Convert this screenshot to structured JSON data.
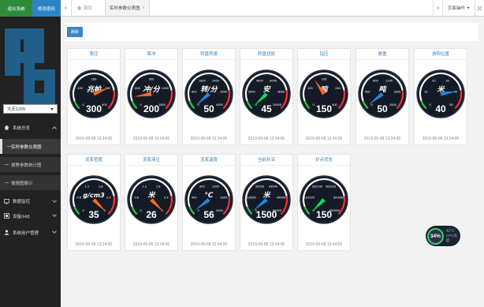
{
  "sidebar": {
    "exit_label": "退出系统",
    "password_label": "修改密码",
    "station": "大庆1205",
    "menu": [
      {
        "label": "系统总览",
        "icon": "home-icon",
        "expanded": true
      },
      {
        "label": "数据监控",
        "icon": "monitor-icon"
      },
      {
        "label": "设备(Hd)",
        "icon": "device-icon"
      },
      {
        "label": "系统用户管理",
        "icon": "user-icon"
      }
    ],
    "submenu": [
      {
        "label": "实时参数仪表图",
        "active": true
      },
      {
        "label": "报警参数统计图"
      },
      {
        "label": "报报图展示"
      }
    ]
  },
  "tabbar": {
    "home_label": "首页",
    "active_tab": "实时参数仪表图",
    "ops_label": "页面操作"
  },
  "content": {
    "refresh_label": "刷新"
  },
  "gauges": [
    {
      "title": "泵压",
      "unit": "兆帕",
      "value": 300,
      "min": 0,
      "max": 400,
      "ticks": [
        "0",
        "120",
        "160",
        "240",
        "400"
      ],
      "time": "2019-05-08 13:24:05",
      "color": "#ff6a1a"
    },
    {
      "title": "泵冲",
      "unit": "冲/分",
      "value": 200,
      "min": 0,
      "max": 1500,
      "ticks": [
        "0",
        "600",
        "900",
        "1200",
        "1500"
      ],
      "time": "2019-05-08 13:24:05",
      "color": "#ff6a1a"
    },
    {
      "title": "转盘转速",
      "unit": "转/分",
      "value": 50,
      "min": 0,
      "max": 4000,
      "ticks": [
        "0",
        "800",
        "1600",
        "2400",
        "3200",
        "4000"
      ],
      "time": "2019-05-08 13:24:05",
      "color": "#1e88e5"
    },
    {
      "title": "转盘扭矩",
      "unit": "安",
      "value": 45,
      "min": 0,
      "max": 10000,
      "ticks": [
        "0",
        "2000",
        "4000",
        "6000",
        "8000",
        "10000"
      ],
      "time": "2019-05-08 13:24:05",
      "color": "#00e65a"
    },
    {
      "title": "钻压",
      "unit": "吨",
      "value": 150,
      "min": 0,
      "max": 400,
      "ticks": [
        "0",
        "120",
        "160",
        "240",
        "400"
      ],
      "time": "2019-05-08 13:24:05",
      "color": "#ff6a1a"
    },
    {
      "title": "悬重",
      "unit": "吨",
      "value": 50,
      "min": 0,
      "max": 2000,
      "ticks": [
        "0",
        "400",
        "800",
        "1200",
        "1600",
        "2000"
      ],
      "time": "2019-05-08 13:24:05",
      "color": "#1e88e5"
    },
    {
      "title": "游钩位置",
      "unit": "米",
      "value": 40,
      "min": 0,
      "max": 50,
      "ticks": [
        "0",
        "10",
        "20",
        "30",
        "40",
        "50"
      ],
      "time": "2019-05-08 13:24:05",
      "color": "#1e88e5"
    },
    {
      "title": "泥浆密度",
      "unit": "g/cm3",
      "value": 35,
      "min": 0,
      "max": 3,
      "ticks": [
        "0",
        "0.6",
        "1.2",
        "1.8",
        "2.4",
        "3"
      ],
      "time": "2019-05-08 13:24:05",
      "color": "#ff6a1a"
    },
    {
      "title": "泥浆液位",
      "unit": "米",
      "value": 26,
      "min": 0,
      "max": 3,
      "ticks": [
        "0",
        "0.6",
        "1.2",
        "1.8",
        "2.4",
        "3"
      ],
      "time": "2019-05-08 13:24:05",
      "color": "#ff6a1a"
    },
    {
      "title": "泥浆温度",
      "unit": "℃",
      "value": 56,
      "min": 0,
      "max": 2000,
      "ticks": [
        "0",
        "400",
        "800",
        "1200",
        "1600",
        "2000"
      ],
      "time": "2019-05-08 13:24:05",
      "color": "#1e88e5"
    },
    {
      "title": "当前井深",
      "unit": "米",
      "value": 1500,
      "min": 0,
      "max": 80000,
      "ticks": [
        "0",
        "16000",
        "32000",
        "48000",
        "64000",
        "80000"
      ],
      "time": "2019-05-08 13:24:05",
      "color": "#1e88e5"
    },
    {
      "title": "井点状态",
      "unit": "",
      "value": 150,
      "min": 0,
      "max": 655350,
      "ticks": [
        "0",
        "131070",
        "262140",
        "393210",
        "524280",
        "655350"
      ],
      "time": "2019-05-08 13:24:05",
      "color": "#00e65a"
    }
  ],
  "cpu": {
    "percent": "34%",
    "temp": "42℃",
    "label": "CPU温度"
  }
}
